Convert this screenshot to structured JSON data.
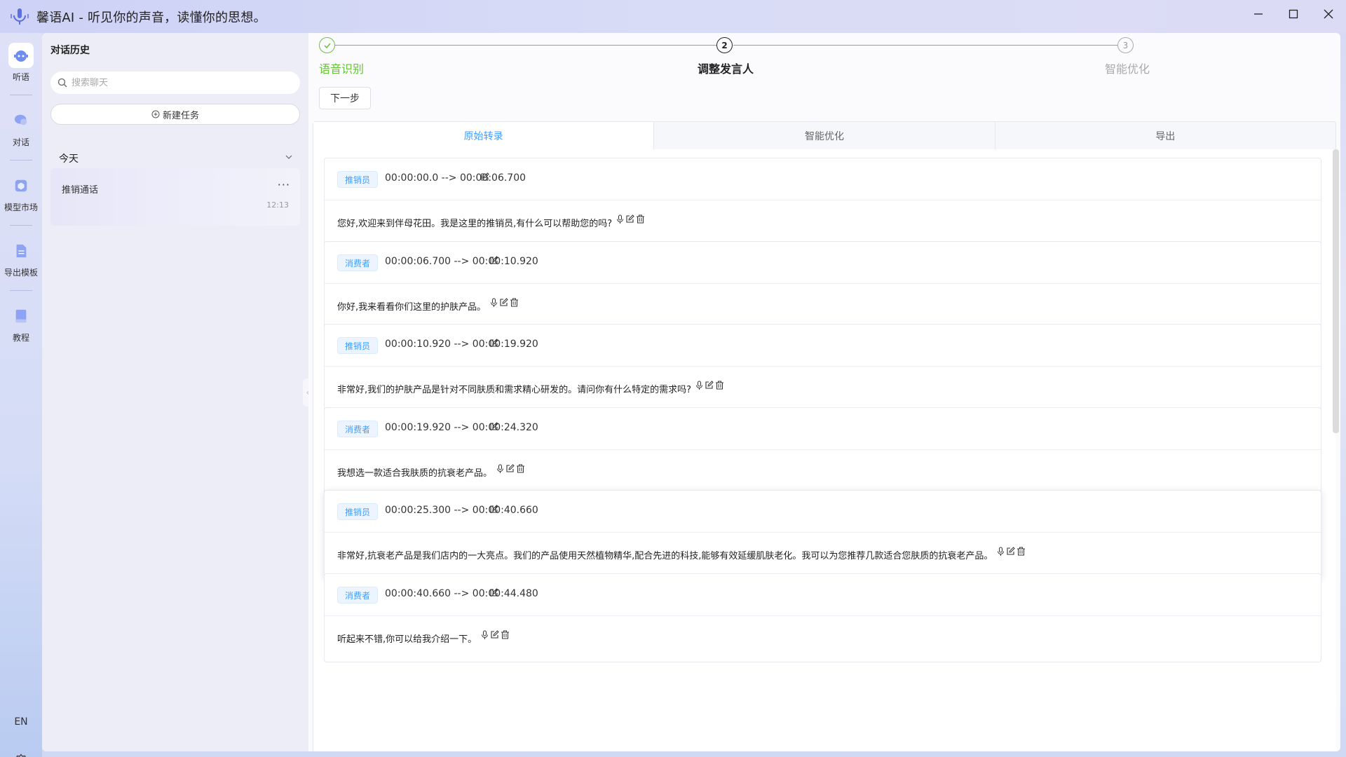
{
  "window": {
    "title": "馨语AI - 听见你的声音，读懂你的思想。"
  },
  "rail": {
    "items": [
      {
        "label": "听语",
        "icon": "robot-icon"
      },
      {
        "label": "对话",
        "icon": "chat-icon"
      },
      {
        "label": "模型市场",
        "icon": "model-market-icon"
      },
      {
        "label": "导出模板",
        "icon": "document-icon"
      },
      {
        "label": "教程",
        "icon": "book-icon"
      }
    ],
    "lang": "EN"
  },
  "history": {
    "title": "对话历史",
    "search_placeholder": "搜索聊天",
    "new_task": "新建任务",
    "group": "今天",
    "conversations": [
      {
        "name": "推销通话",
        "time": "12:13"
      }
    ]
  },
  "steps": [
    {
      "num": "1",
      "label": "语音识别",
      "status": "done"
    },
    {
      "num": "2",
      "label": "调整发言人",
      "status": "active"
    },
    {
      "num": "3",
      "label": "智能优化",
      "status": "pending"
    }
  ],
  "next_button": "下一步",
  "tabs": [
    "原始转录",
    "智能优化",
    "导出"
  ],
  "active_tab": "原始转录",
  "segments": [
    {
      "speaker": "推销员",
      "time": "00:00:00.0 --> 00:00:06.700",
      "text": "您好,欢迎来到伴母花田。我是这里的推销员,有什么可以帮助您的吗?"
    },
    {
      "speaker": "消费者",
      "time": "00:00:06.700 --> 00:00:10.920",
      "text": "你好,我来看看你们这里的护肤产品。"
    },
    {
      "speaker": "推销员",
      "time": "00:00:10.920 --> 00:00:19.920",
      "text": "非常好,我们的护肤产品是针对不同肤质和需求精心研发的。请问你有什么特定的需求吗?"
    },
    {
      "speaker": "消费者",
      "time": "00:00:19.920 --> 00:00:24.320",
      "text": "我想选一款适合我肤质的抗衰老产品。"
    },
    {
      "speaker": "推销员",
      "time": "00:00:25.300 --> 00:00:40.660",
      "text": "非常好,抗衰老产品是我们店内的一大亮点。我们的产品使用天然植物精华,配合先进的科技,能够有效延缓肌肤老化。我可以为您推荐几款适合您肤质的抗衰老产品。"
    },
    {
      "speaker": "消费者",
      "time": "00:00:40.660 --> 00:00:44.480",
      "text": "听起来不错,你可以给我介绍一下。"
    }
  ],
  "colors": {
    "accent": "#409eff",
    "done": "#67c23a",
    "tag_bg": "#ecf5ff"
  }
}
